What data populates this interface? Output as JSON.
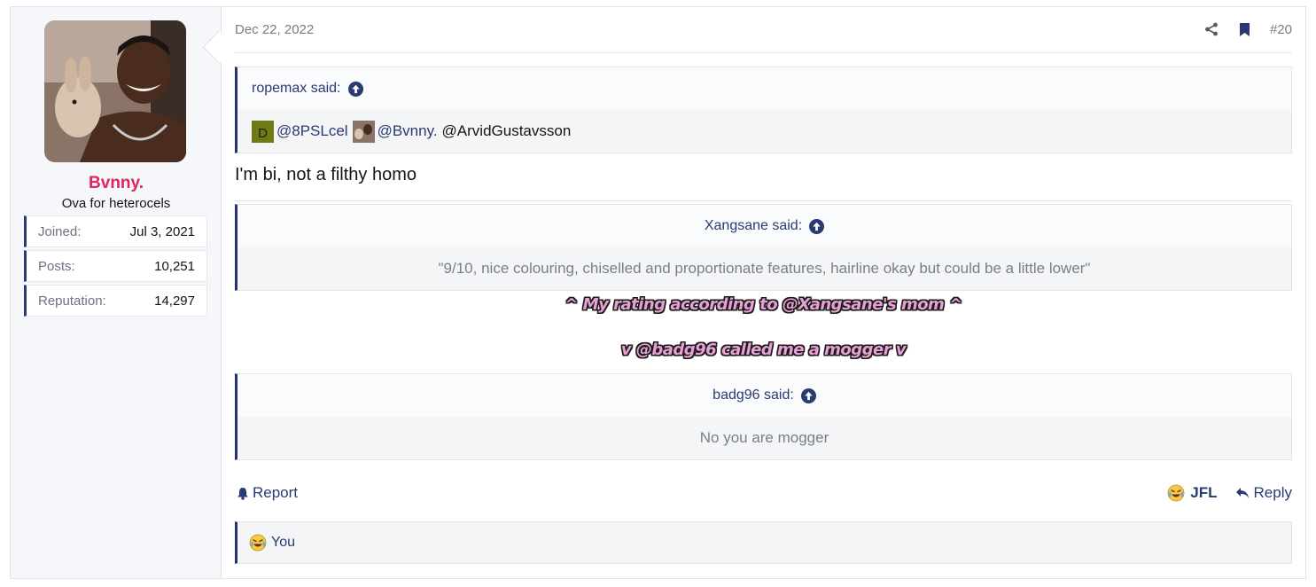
{
  "user": {
    "name": "Bvnny.",
    "title": "Ova for heterocels",
    "stats": [
      {
        "label": "Joined:",
        "value": "Jul 3, 2021"
      },
      {
        "label": "Posts:",
        "value": "10,251"
      },
      {
        "label": "Reputation:",
        "value": "14,297"
      }
    ]
  },
  "post": {
    "date": "Dec 22, 2022",
    "number": "#20",
    "message": "I'm bi, not a filthy homo",
    "quote1": {
      "author": "ropemax said:",
      "mention1": "@8PSLcel",
      "mention1_avatar_letter": "D",
      "mention2": "@Bvnny.",
      "mention3": "@ArvidGustavsson"
    },
    "quote2": {
      "author": "Xangsane said:",
      "text": "\"9/10, nice colouring, chiselled and proportionate features, hairline okay but could be a little lower\""
    },
    "bubble_text_1": "^ My rating according to @Xangsane's mom ^",
    "bubble_text_2": "v @badg96 called me a mogger v",
    "quote3": {
      "author": "badg96 said:",
      "text": "No you are mogger"
    }
  },
  "actions": {
    "report": "Report",
    "jfl": "JFL",
    "reply": "Reply"
  },
  "reactions": {
    "text": "You"
  },
  "colors": {
    "accent": "#2a3a72",
    "username": "#e0245e",
    "quote_border": "#23346e"
  }
}
